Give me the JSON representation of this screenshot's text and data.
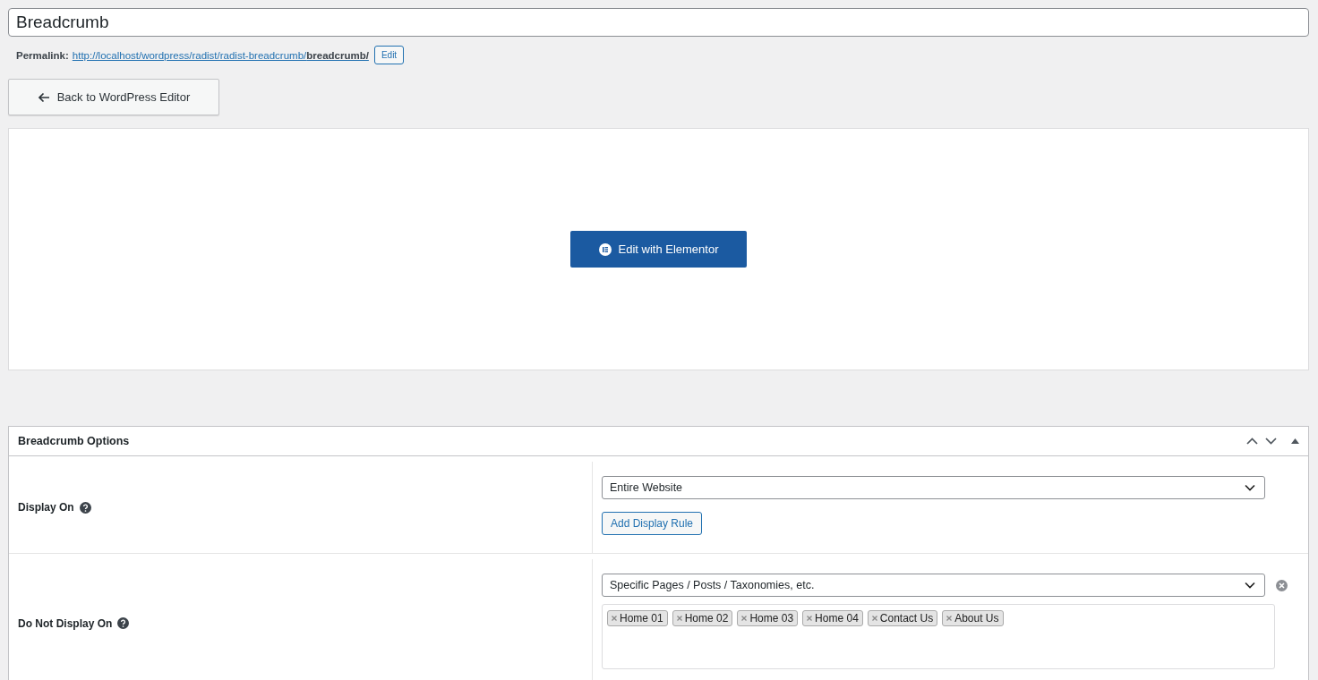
{
  "title_field": {
    "value": "Breadcrumb"
  },
  "permalink": {
    "label": "Permalink:",
    "url": "http://localhost/wordpress/radist/radist-breadcrumb/**breadcrumb/**",
    "edit_button": "Edit"
  },
  "back_button": "Back to WordPress Editor",
  "elementor_button": "Edit with Elementor",
  "metabox": {
    "title": "Breadcrumb Options",
    "rows": [
      {
        "label": "Display On",
        "select": "Entire Website",
        "button": "Add Display Rule",
        "removable": false,
        "tags": []
      },
      {
        "label": "Do Not Display On",
        "select": "Specific Pages / Posts / Taxonomies, etc.",
        "removable": true,
        "tags": [
          "Home 01",
          "Home 02",
          "Home 03",
          "Home 04",
          "Contact Us",
          "About Us"
        ]
      }
    ]
  }
}
